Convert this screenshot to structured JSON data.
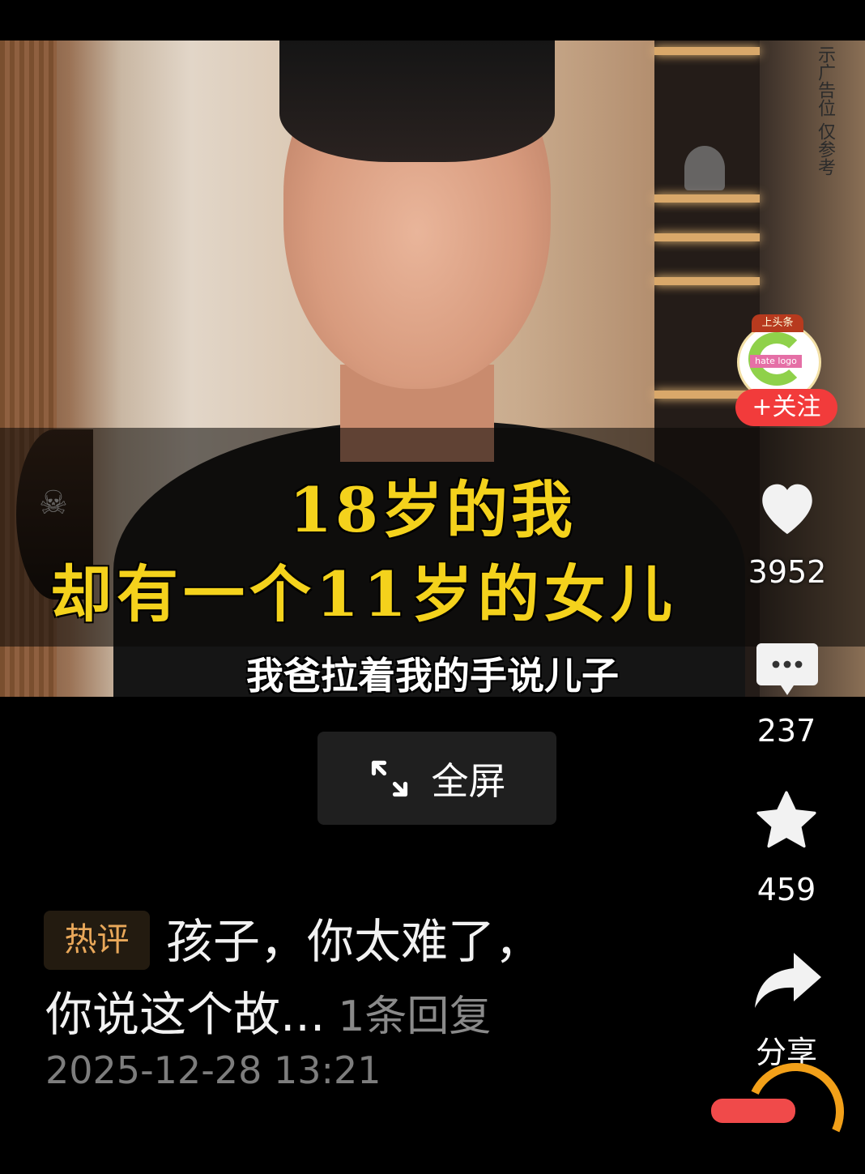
{
  "video": {
    "caption_line1": "18岁的我",
    "caption_line2": "却有一个11岁的女儿",
    "subtitle": "我爸拉着我的手说儿子",
    "watermark": "示广告位 仅参考"
  },
  "author": {
    "avatar_banner": "上头条",
    "avatar_tag": "hate logo",
    "follow_label": "+关注"
  },
  "actions": {
    "likes": "3952",
    "comments": "237",
    "favorites": "459",
    "share_label": "分享"
  },
  "fullscreen": {
    "label": "全屏"
  },
  "hot_comment": {
    "tag": "热评",
    "text_line1": "孩子，你太难了，",
    "text_line2": "你说这个故...",
    "reply_count": "1条回复",
    "timestamp": "2025-12-28 13:21"
  },
  "colors": {
    "caption": "#f4d21c",
    "follow_button": "#f23b3b",
    "hot_tag_text": "#e9a85a"
  }
}
